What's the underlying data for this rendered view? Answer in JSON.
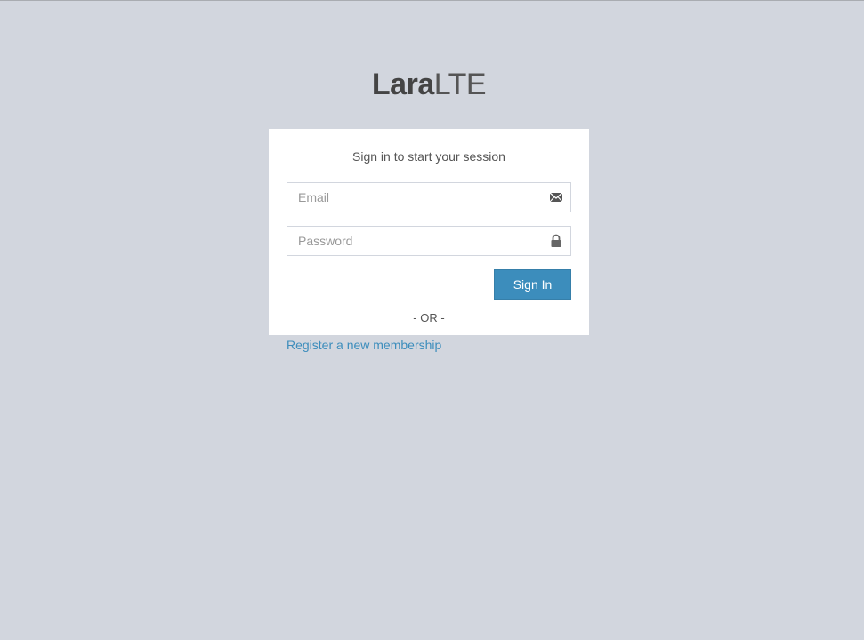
{
  "logo": {
    "bold": "Lara",
    "thin": "LTE"
  },
  "login": {
    "message": "Sign in to start your session",
    "email_placeholder": "Email",
    "email_value": "",
    "password_placeholder": "Password",
    "password_value": "",
    "signin_label": "Sign In",
    "or_text": "- OR -",
    "register_link": "Register a new membership"
  },
  "icons": {
    "email": "envelope-icon",
    "password": "lock-icon"
  },
  "colors": {
    "background": "#d2d6de",
    "primary": "#3c8dbc",
    "card": "#ffffff"
  }
}
